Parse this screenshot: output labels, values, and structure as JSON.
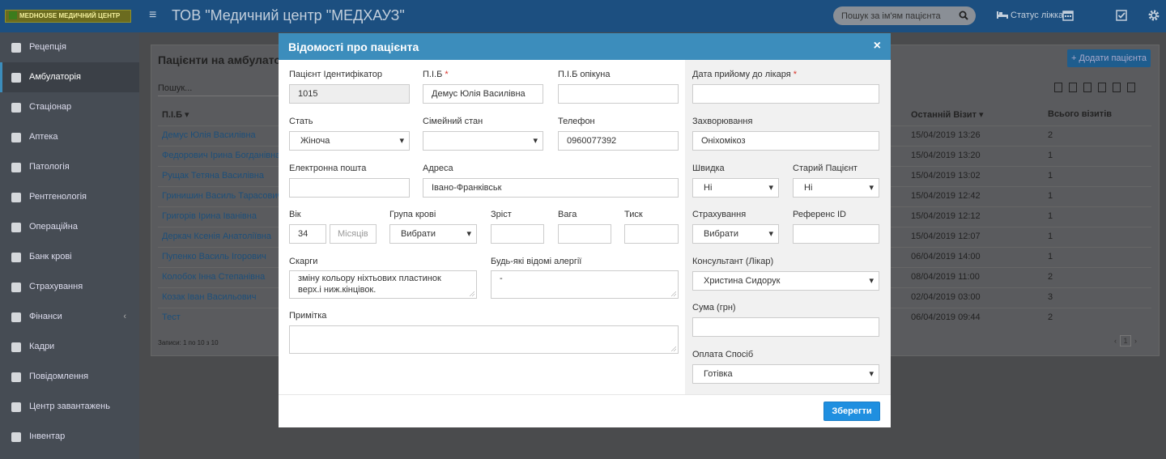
{
  "topbar": {
    "logo_text": "MEDHOUSE МЕДИЧНИЙ ЦЕНТР",
    "app_title": "ТОВ \"Медичний центр \"МЕДХАУЗ\"",
    "search_placeholder": "Пошук за ім'ям пацієнта",
    "bed_status": "Статус ліжка"
  },
  "sidebar": {
    "items": [
      {
        "label": "Рецепція",
        "icon": "building-icon"
      },
      {
        "label": "Амбулаторія",
        "icon": "stethoscope-icon"
      },
      {
        "label": "Стаціонар",
        "icon": "bed-icon"
      },
      {
        "label": "Аптека",
        "icon": "mortar-icon"
      },
      {
        "label": "Патологія",
        "icon": "flask-icon"
      },
      {
        "label": "Рентгенологія",
        "icon": "xray-icon"
      },
      {
        "label": "Операційна",
        "icon": "scissors-icon"
      },
      {
        "label": "Банк крові",
        "icon": "blood-drop-icon"
      },
      {
        "label": "Страхування",
        "icon": "umbrella-icon"
      },
      {
        "label": "Фінанси",
        "icon": "money-icon"
      },
      {
        "label": "Кадри",
        "icon": "org-chart-icon"
      },
      {
        "label": "Повідомлення",
        "icon": "megaphone-icon"
      },
      {
        "label": "Центр завантажень",
        "icon": "download-icon"
      },
      {
        "label": "Інвентар",
        "icon": "inventory-icon"
      }
    ]
  },
  "background": {
    "panel_title": "Пацієнти на амбулато",
    "add_button": "+ Додати пацієнта",
    "search_placeholder": "Пошук...",
    "columns": {
      "name": "П.І.Б",
      "last_visit": "Останній Візит",
      "total_visits": "Всього візитів"
    },
    "rows": [
      {
        "name": "Демус Юлія Василівна",
        "last_visit": "15/04/2019 13:26",
        "visits": "2"
      },
      {
        "name": "Федорович Ірина Богданівна",
        "last_visit": "15/04/2019 13:20",
        "visits": "1"
      },
      {
        "name": "Рущак Тетяна Василівна",
        "last_visit": "15/04/2019 13:02",
        "visits": "1"
      },
      {
        "name": "Гринишин Василь Тарасович",
        "last_visit": "15/04/2019 12:42",
        "visits": "1"
      },
      {
        "name": "Григорів Ірина Іванівна",
        "last_visit": "15/04/2019 12:12",
        "visits": "1"
      },
      {
        "name": "Деркач Ксенія Анатоліївна",
        "last_visit": "15/04/2019 12:07",
        "visits": "1"
      },
      {
        "name": "Пупенко Василь Ігорович",
        "last_visit": "06/04/2019 14:00",
        "visits": "1"
      },
      {
        "name": "Колобок Інна Степанівна",
        "last_visit": "08/04/2019 11:00",
        "visits": "2"
      },
      {
        "name": "Козак Іван Васильович",
        "last_visit": "02/04/2019 03:00",
        "visits": "3"
      },
      {
        "name": "Тест",
        "last_visit": "06/04/2019 09:44",
        "visits": "2"
      }
    ],
    "records_text": "Записи: 1 по 10 з 10",
    "current_page": "1"
  },
  "modal": {
    "title": "Відомості про пацієнта",
    "fields": {
      "patient_id_label": "Пацієнт Ідентифікатор",
      "patient_id_value": "1015",
      "full_name_label": "П.І.Б",
      "full_name_value": "Демус Юлія Василівна",
      "guardian_label": "П.І.Б опікуна",
      "guardian_value": "",
      "sex_label": "Стать",
      "sex_value": "Жіноча",
      "marital_label": "Сімейний стан",
      "marital_value": "",
      "phone_label": "Телефон",
      "phone_value": "0960077392",
      "email_label": "Електронна пошта",
      "email_value": "",
      "address_label": "Адреса",
      "address_value": "Івано-Франківськ",
      "age_label": "Вік",
      "age_value": "34",
      "months_placeholder": "Місяців",
      "blood_label": "Група крові",
      "blood_value": "Вибрати",
      "height_label": "Зріст",
      "weight_label": "Вага",
      "pressure_label": "Тиск",
      "complaints_label": "Скарги",
      "complaints_value": "зміну кольору ніхтьових пластинок\nверх.і ниж.кінцівок.",
      "allergies_label": "Будь-які відомі алергії",
      "allergies_value": "-",
      "note_label": "Примітка",
      "note_value": "",
      "visit_date_label": "Дата прийому до лікаря",
      "visit_date_value": "",
      "disease_label": "Захворювання",
      "disease_value": "Оніхомікоз",
      "quick_label": "Швидка",
      "quick_value": "Ні",
      "old_patient_label": "Старий Пацієнт",
      "old_patient_value": "Ні",
      "insurance_label": "Страхування",
      "insurance_value": "Вибрати",
      "reference_label": "Референс ID",
      "reference_value": "",
      "consultant_label": "Консультант (Лікар)",
      "consultant_value": "Христина Сидорук",
      "amount_label": "Сума (грн)",
      "amount_value": "",
      "payment_label": "Оплата Спосіб",
      "payment_value": "Готівка"
    },
    "required_mark": "*",
    "save_button": "Зберегти",
    "close_glyph": "×"
  },
  "colors": {
    "header": "#1c4f80",
    "modal_header": "#3c8dbc",
    "save": "#1f8fe0",
    "required": "#d9342b"
  }
}
